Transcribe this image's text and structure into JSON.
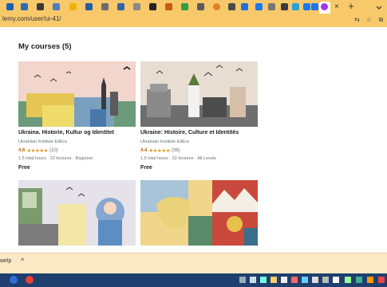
{
  "browser": {
    "url": "lemy.com/user/ui-41/",
    "tab_close": "×",
    "new_tab": "+"
  },
  "page": {
    "heading": "My courses (5)"
  },
  "courses": [
    {
      "title": "Ukraina. Historie, Kultur og Identitet",
      "instructor": "Ukrainian Institute EdEra",
      "rating": "4.6",
      "stars": "★★★★★",
      "count": "(10)",
      "meta": "1.5 total hours · 22 lectures · Beginner",
      "price": "Free"
    },
    {
      "title": "Ukraine: Histoire, Culture et Identités",
      "instructor": "Ukrainian Institute EdEra",
      "rating": "4.4",
      "stars": "★★★★★",
      "count": "(36)",
      "meta": "1.5 total hours · 22 lectures · All Levels",
      "price": "Free"
    }
  ],
  "download_bar": {
    "item": "welp",
    "chevron": "^"
  },
  "colors": {
    "chrome": "#f7c96b",
    "star": "#e59819",
    "rating_text": "#b4690e",
    "taskbar": "#1f3f6e"
  }
}
